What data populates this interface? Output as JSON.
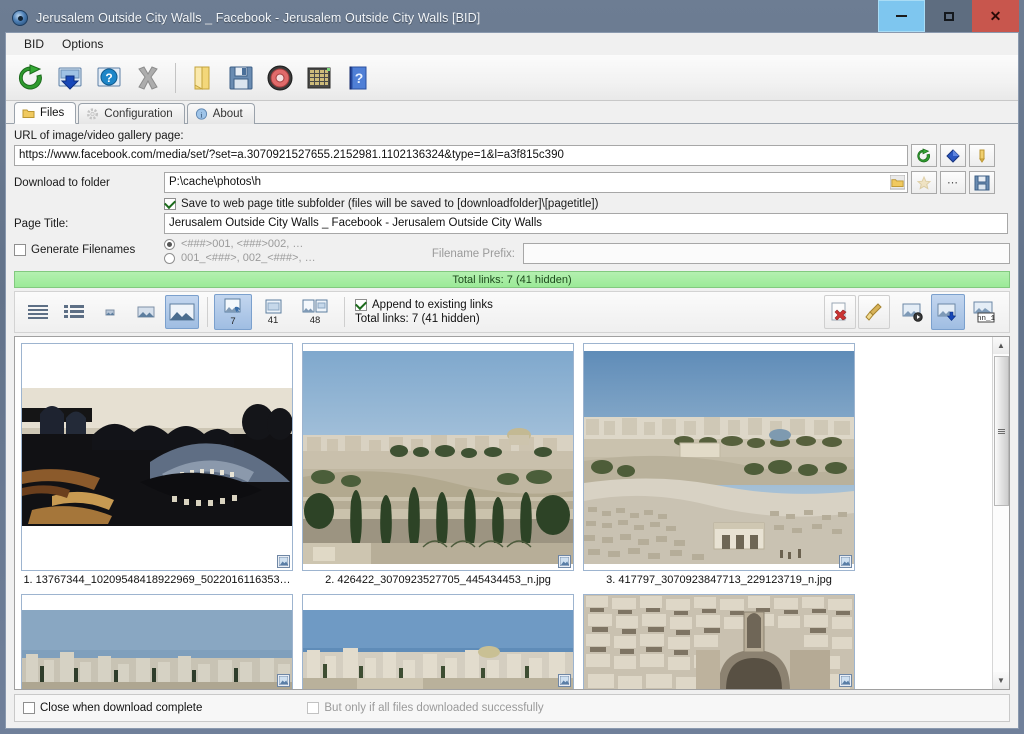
{
  "window": {
    "title": "Jerusalem Outside City Walls _ Facebook - Jerusalem Outside City Walls [BID]",
    "app_icon": "bid-globe-icon",
    "controls": {
      "minimize": "–",
      "maximize": "□",
      "close": "✕"
    }
  },
  "menubar": {
    "items": [
      {
        "label": "BID"
      },
      {
        "label": "Options"
      }
    ]
  },
  "toolbar": {
    "buttons": [
      {
        "name": "refresh-button",
        "icon": "green-refresh-icon"
      },
      {
        "name": "download-button",
        "icon": "blue-download-icon"
      },
      {
        "name": "help-button",
        "icon": "blue-question-icon"
      },
      {
        "name": "stop-button",
        "icon": "gray-x-icon"
      },
      {
        "name": "open-folder-button",
        "icon": "yellow-folder-icon"
      },
      {
        "name": "save-button",
        "icon": "floppy-disk-icon"
      },
      {
        "name": "settings-button",
        "icon": "red-target-icon"
      },
      {
        "name": "grid-button",
        "icon": "grid-icon"
      },
      {
        "name": "about-button",
        "icon": "blue-book-question-icon"
      }
    ]
  },
  "tabs": [
    {
      "label": "Files",
      "icon": "folder-icon",
      "active": true
    },
    {
      "label": "Configuration",
      "icon": "gear-icon",
      "active": false
    },
    {
      "label": "About",
      "icon": "info-icon",
      "active": false
    }
  ],
  "form": {
    "url_label": "URL of image/video gallery page:",
    "url_value": "https://www.facebook.com/media/set/?set=a.3070921527655.2152981.1102136324&type=1&l=a3f815c390",
    "url_buttons": [
      {
        "name": "url-refresh-button",
        "icon": "green-refresh-icon"
      },
      {
        "name": "url-download-button",
        "icon": "blue-diamond-icon"
      },
      {
        "name": "url-auth-button",
        "icon": "yellow-key-icon"
      }
    ],
    "folder_label": "Download to folder",
    "folder_value": "P:\\cache\\photos\\h",
    "folder_inline_icon": "browse-folder-icon",
    "folder_buttons": [
      {
        "name": "folder-favorite-button",
        "icon": "star-icon"
      },
      {
        "name": "folder-more-button",
        "icon": "ellipsis-icon"
      },
      {
        "name": "folder-save-button",
        "icon": "floppy-disk-icon"
      }
    ],
    "subfolder_checkbox": {
      "label": "Save to web page title subfolder (files will be saved to [downloadfolder]\\[pagetitle])",
      "checked": true
    },
    "pagetitle_label": "Page Title:",
    "pagetitle_value": "Jerusalem Outside City Walls _ Facebook - Jerusalem Outside City Walls",
    "generate_filenames": {
      "label": "Generate Filenames",
      "checked": false
    },
    "filename_patterns": [
      {
        "label": "<###>001, <###>002, …",
        "selected": true
      },
      {
        "label": "001_<###>, 002_<###>, …",
        "selected": false
      }
    ],
    "prefix_label": "Filename Prefix:",
    "prefix_value": ""
  },
  "status_bar": {
    "text": "Total links: 7 (41 hidden)",
    "color": "#9bea97"
  },
  "viewbar": {
    "view_modes": [
      {
        "name": "list-view-button",
        "icon": "lines-icon",
        "selected": false
      },
      {
        "name": "detail-view-button",
        "icon": "detail-list-icon",
        "selected": false
      },
      {
        "name": "thumb-small-button",
        "icon": "small-image-icon",
        "selected": false
      },
      {
        "name": "thumb-medium-button",
        "icon": "medium-image-icon",
        "selected": false
      },
      {
        "name": "thumb-large-button",
        "icon": "large-image-icon",
        "selected": true
      }
    ],
    "filters": [
      {
        "name": "filter-images-button",
        "icon": "image-link-icon",
        "count": "7",
        "selected": true
      },
      {
        "name": "filter-pages-button",
        "icon": "page-icon",
        "count": "41",
        "selected": false
      },
      {
        "name": "filter-all-button",
        "icon": "all-links-icon",
        "count": "48",
        "selected": false
      }
    ],
    "append_checkbox": {
      "label": "Append to existing links",
      "checked": true
    },
    "total_text": "Total links: 7 (41 hidden)",
    "actions": [
      {
        "name": "delete-link-button",
        "icon": "page-red-x-icon"
      },
      {
        "name": "clear-links-button",
        "icon": "broom-icon"
      },
      {
        "name": "preview-button",
        "icon": "image-play-icon"
      },
      {
        "name": "download-selected-button",
        "icon": "image-download-icon",
        "selected": true
      },
      {
        "name": "rename-button",
        "icon": "rename-icon",
        "caption": "nn_1"
      }
    ]
  },
  "gallery": {
    "items": [
      {
        "caption": "1. 13767344_10209548418922969_5022016116353…",
        "scene": "night-panorama",
        "badge": "image-info-icon"
      },
      {
        "caption": "2. 426422_3070923527705_445434453_n.jpg",
        "scene": "jerusalem-cityscape",
        "badge": "image-info-icon"
      },
      {
        "caption": "3. 417797_3070923847713_229123719_n.jpg",
        "scene": "mount-of-olives",
        "badge": "image-info-icon"
      },
      {
        "caption": "",
        "scene": "city-skyline-1",
        "badge": "image-info-icon"
      },
      {
        "caption": "",
        "scene": "city-skyline-2",
        "badge": "image-info-icon"
      },
      {
        "caption": "",
        "scene": "cemetery-stones",
        "badge": "image-info-icon"
      }
    ],
    "scrollbar": {
      "up_arrow": "▲",
      "down_arrow": "▼"
    }
  },
  "bottom_bar": {
    "close_when_complete": {
      "label": "Close when download complete",
      "checked": false
    },
    "only_if_success": {
      "label": "But only if all files downloaded successfully",
      "checked": false,
      "disabled": true
    }
  }
}
